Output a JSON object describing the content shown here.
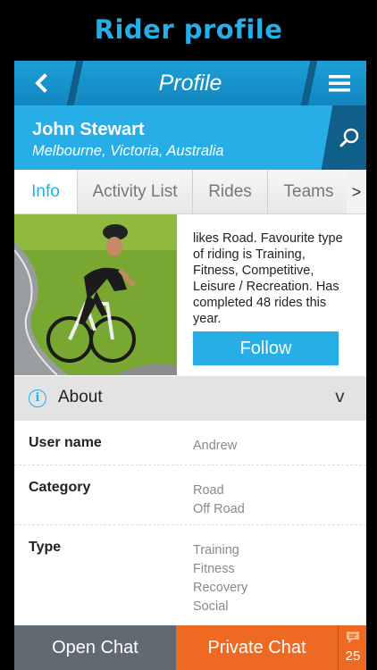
{
  "promo": {
    "title": "Rider profile"
  },
  "nav": {
    "title": "Profile",
    "back_icon": "chevron-left-icon",
    "menu_icon": "hamburger-menu-icon"
  },
  "header": {
    "name": "John Stewart",
    "location": "Melbourne, Victoria, Australia",
    "search_icon": "search-icon"
  },
  "tabs": [
    {
      "label": "Info",
      "active": true
    },
    {
      "label": "Activity List",
      "active": false
    },
    {
      "label": "Rides",
      "active": false
    },
    {
      "label": "Teams",
      "active": false
    }
  ],
  "tabs_more": ">",
  "profile": {
    "bio": "likes Road. Favourite type of riding is Training, Fitness, Competitive, Leisure / Recreation. Has completed 48 rides this year.",
    "follow_label": "Follow"
  },
  "about": {
    "icon_glyph": "i",
    "label": "About",
    "chevron": "v"
  },
  "details": [
    {
      "label": "User name",
      "values": [
        "Andrew"
      ]
    },
    {
      "label": "Category",
      "values": [
        "Road",
        "Off Road"
      ]
    },
    {
      "label": "Type",
      "values": [
        "Training",
        "Fitness",
        "Recovery",
        "Social"
      ]
    }
  ],
  "bottom": {
    "open_chat": "Open Chat",
    "private_chat": "Private Chat",
    "chat_count": "25"
  },
  "colors": {
    "accent": "#27aee6",
    "nav_dark": "#0f5f8a",
    "orange": "#ee6a22",
    "grey_button": "#616a73"
  }
}
